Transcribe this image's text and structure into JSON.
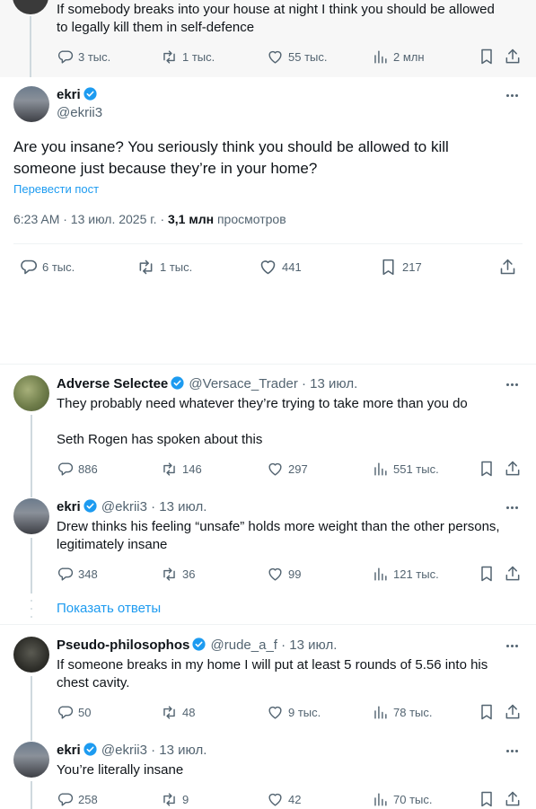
{
  "parent_tweet": {
    "text_line1": "If somebody breaks into your house at night I think you should be allowed",
    "text_line2": "to legally kill them in self-defence",
    "replies": "3 тыс.",
    "reposts": "1 тыс.",
    "likes": "55 тыс.",
    "views": "2 млн"
  },
  "main_tweet": {
    "name": "ekri",
    "handle": "@ekrii3",
    "text_line1": "Are you insane? You seriously think you should be allowed to kill",
    "text_line2": "someone just because they’re in your home?",
    "translate": "Перевести пост",
    "time_date": "6:23 AM · 13 июл. 2025 г. · ",
    "views_count": "3,1 млн",
    "views_label": " просмотров",
    "replies": "6 тыс.",
    "reposts": "1 тыс.",
    "likes": "441",
    "bookmarks": "217"
  },
  "replies": [
    {
      "name": "Adverse Selectee",
      "handle": "@Versace_Trader",
      "time": "· 13 июл.",
      "line1": "They probably need whatever they’re trying to take more than you do",
      "line2": "",
      "line3": "Seth Rogen has spoken about this",
      "replies": "886",
      "reposts": "146",
      "likes": "297",
      "views": "551 тыс."
    },
    {
      "name": "ekri",
      "handle": "@ekrii3",
      "time": "· 13 июл.",
      "line1": "Drew thinks his feeling “unsafe” holds more weight than the other persons,",
      "line2": "legitimately insane",
      "replies": "348",
      "reposts": "36",
      "likes": "99",
      "views": "121 тыс."
    },
    {
      "name": "Pseudo-philosophos",
      "handle": "@rude_a_f",
      "time": "· 13 июл.",
      "line1": "If someone breaks in my home I will put at least 5 rounds of 5.56 into his",
      "line2": "chest cavity.",
      "replies": "50",
      "reposts": "48",
      "likes": "9 тыс.",
      "views": "78 тыс."
    },
    {
      "name": "ekri",
      "handle": "@ekrii3",
      "time": "· 13 июл.",
      "line1": "You’re literally insane",
      "replies": "258",
      "reposts": "9",
      "likes": "42",
      "views": "70 тыс."
    }
  ],
  "show_replies": "Показать ответы",
  "colors": {
    "accent": "#1d9bf0",
    "muted": "#536471",
    "text": "#0f1419"
  },
  "icons": [
    "reply-icon",
    "repost-icon",
    "like-icon",
    "views-icon",
    "bookmark-icon",
    "share-icon",
    "verified-badge-icon",
    "more-icon"
  ]
}
